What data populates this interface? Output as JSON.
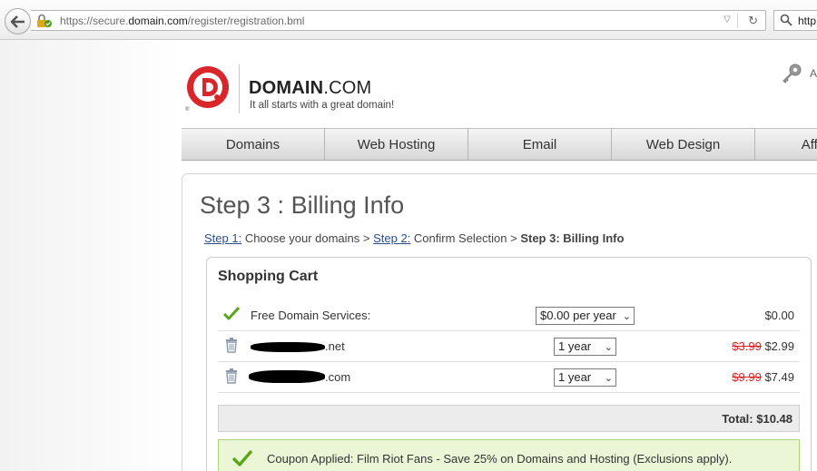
{
  "browser": {
    "url_prefix": "https://secure.",
    "url_domain": "domain.com",
    "url_path": "/register/registration.bml",
    "search_text": "http"
  },
  "header": {
    "brand_bold": "DOMAIN",
    "brand_suffix": ".COM",
    "tagline": "It all starts with a great domain!",
    "account_label": "A"
  },
  "nav": {
    "items": [
      "Domains",
      "Web Hosting",
      "Email",
      "Web Design",
      "Affiliates"
    ]
  },
  "page": {
    "title": "Step 3 : Billing Info",
    "steps": {
      "step1_link": "Step 1:",
      "step1_text": " Choose your domains > ",
      "step2_link": "Step 2:",
      "step2_text": " Confirm Selection > ",
      "step3": "Step 3: Billing Info"
    }
  },
  "cart": {
    "title": "Shopping Cart",
    "rows": [
      {
        "label": "Free Domain Services:",
        "select": "$0.00 per year",
        "old_price": "",
        "price": "$0.00"
      },
      {
        "label_suffix": ".net",
        "select": "1 year",
        "old_price": "$3.99",
        "price": "$2.99"
      },
      {
        "label_suffix": ".com",
        "select": "1 year",
        "old_price": "$9.99",
        "price": "$7.49"
      }
    ],
    "total": "Total: $10.48",
    "coupon": "Coupon Applied: Film Riot Fans - Save 25% on Domains and Hosting (Exclusions apply)."
  },
  "colors": {
    "accent_red": "#d9262b",
    "link_blue": "#2a4f8f",
    "check_green": "#5aa519",
    "strike_red": "#e02020"
  }
}
